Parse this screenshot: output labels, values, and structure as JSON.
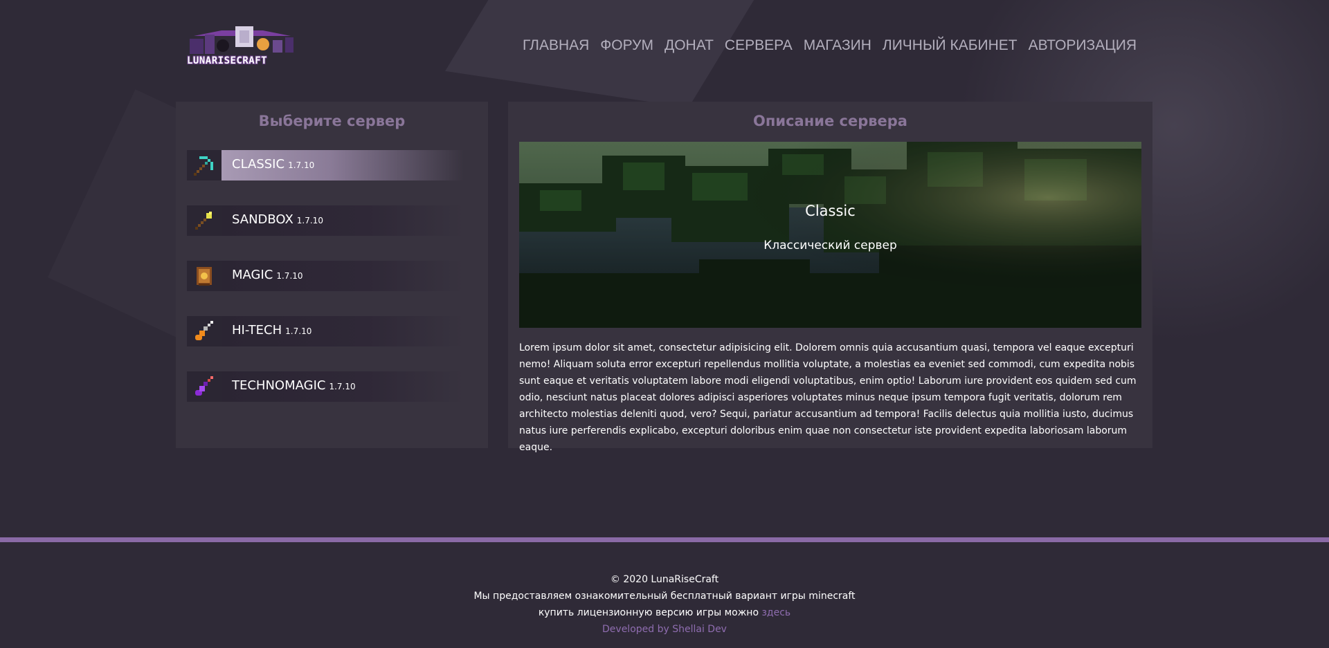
{
  "header": {
    "logo_text": "LUNARISECRAFT",
    "nav": [
      "ГЛАВНАЯ",
      "ФОРУМ",
      "ДОНАТ",
      "СЕРВЕРА",
      "МАГАЗИН",
      "ЛИЧНЫЙ КАБИНЕТ",
      "АВТОРИЗАЦИЯ"
    ]
  },
  "servers_panel": {
    "title": "Выберите сервер",
    "items": [
      {
        "name": "CLASSIC",
        "version": "1.7.10",
        "icon": "pickaxe-icon",
        "active": true
      },
      {
        "name": "SANDBOX",
        "version": "1.7.10",
        "icon": "shovel-icon",
        "active": false
      },
      {
        "name": "MAGIC",
        "version": "1.7.10",
        "icon": "spellbook-icon",
        "active": false
      },
      {
        "name": "HI-TECH",
        "version": "1.7.10",
        "icon": "drill-icon",
        "active": false
      },
      {
        "name": "TECHNOMAGIC",
        "version": "1.7.10",
        "icon": "wand-icon",
        "active": false
      }
    ]
  },
  "description_panel": {
    "title": "Описание сервера",
    "preview_title": "Classic",
    "preview_subtitle": "Классический сервер",
    "text": "Lorem ipsum dolor sit amet, consectetur adipisicing elit. Dolorem omnis quia accusantium quasi, tempora vel eaque excepturi nemo! Aliquam soluta error excepturi repellendus mollitia voluptate, a molestias ea eveniet sed commodi, cum expedita nobis sunt eaque et veritatis voluptatem labore modi eligendi voluptatibus, enim optio! Laborum iure provident eos quidem sed cum odio, nesciunt natus placeat dolores adipisci asperiores voluptates minus neque ipsum tempora fugit veritatis, dolorum rem architecto molestias deleniti quod, vero? Sequi, pariatur accusantium ad tempora! Facilis delectus quia mollitia iusto, ducimus natus iure perferendis explicabo, excepturi doloribus enim quae non consectetur iste provident expedita laboriosam laborum eaque."
  },
  "footer": {
    "copyright": "© 2020 LunaRiseCraft",
    "line2": "Мы предоставляем ознакомительный бесплатный вариант игры minecraft",
    "line3_prefix": "купить лицензионную версию игры можно",
    "line3_link": "здесь",
    "developer": "Developed by Shellai Dev"
  },
  "colors": {
    "background": "#2f2a37",
    "panel": "#38333f",
    "accent": "#8a6aa6",
    "panel_title": "#8a7699"
  }
}
